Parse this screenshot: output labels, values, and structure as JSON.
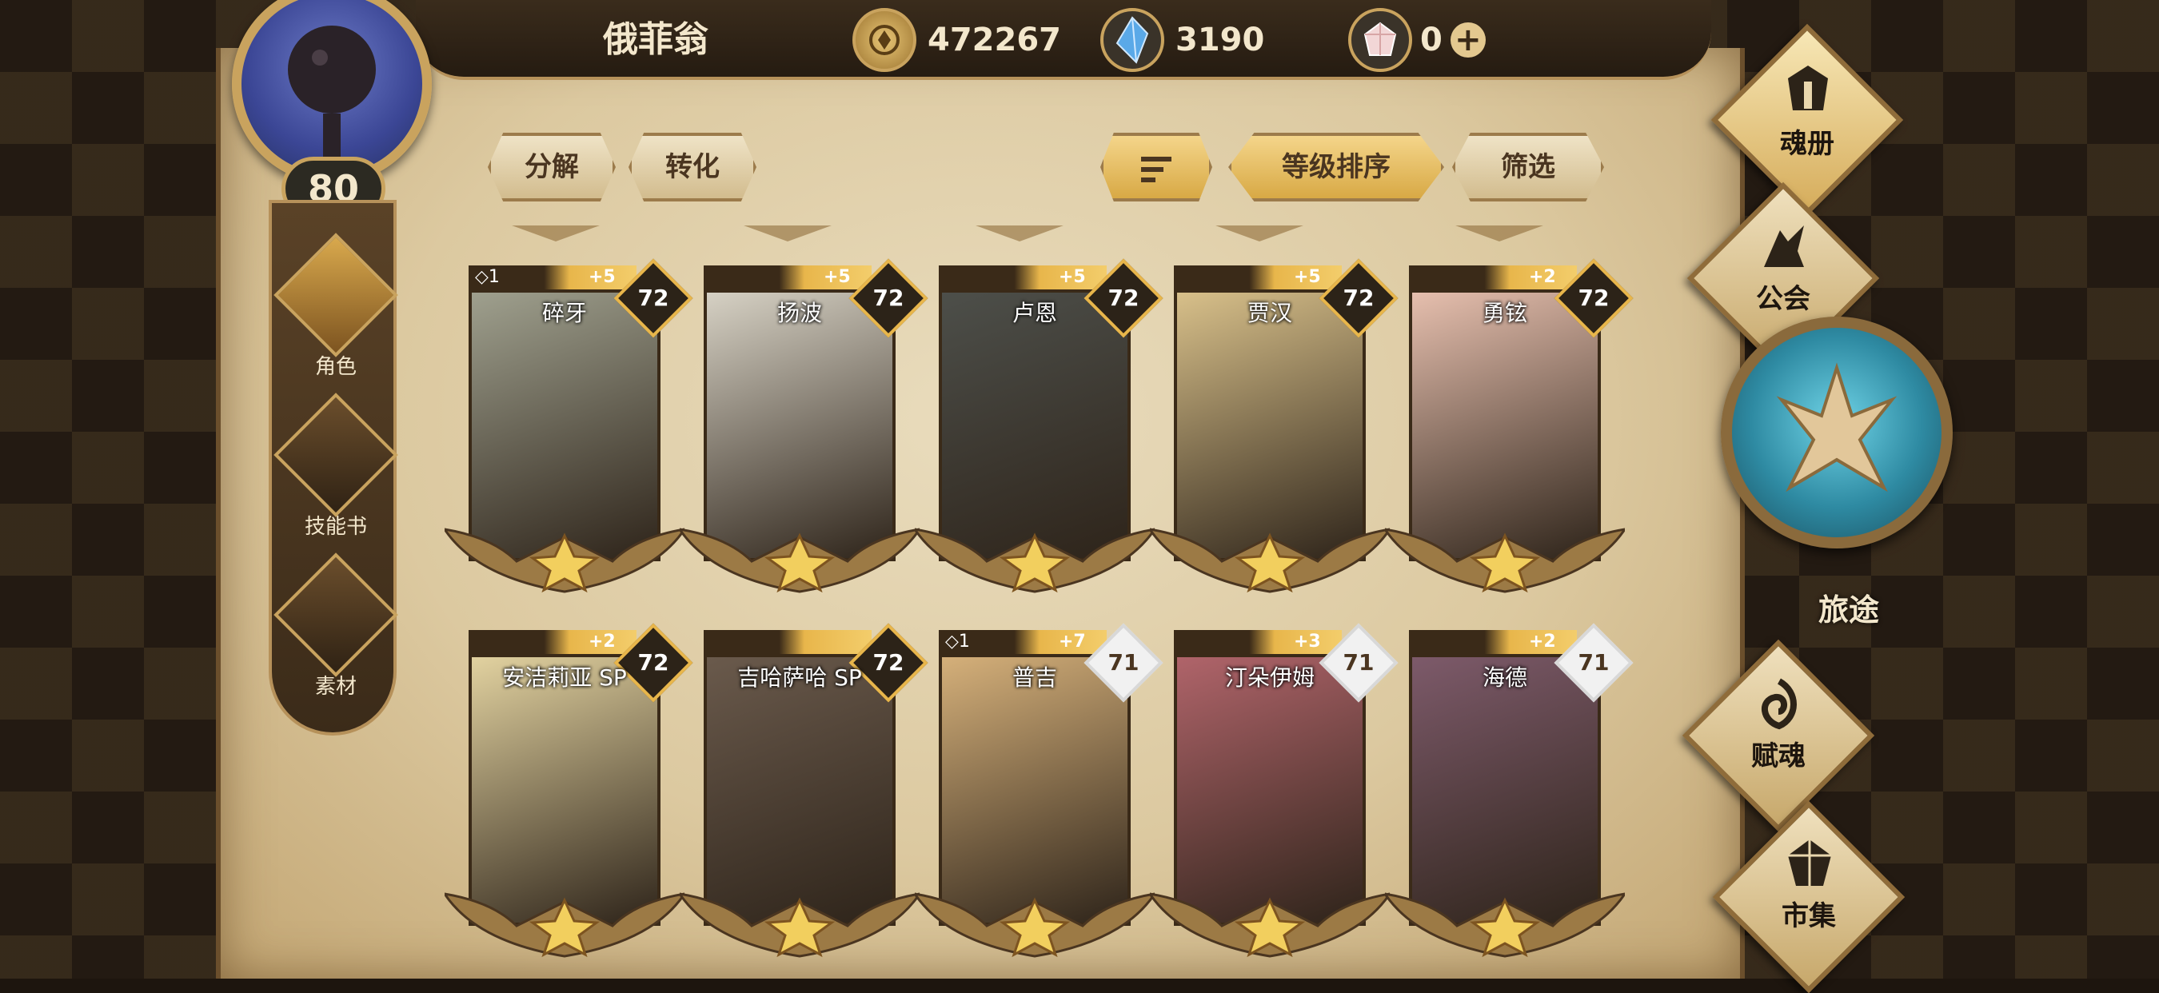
{
  "header": {
    "player_name": "俄菲翁",
    "player_level": "80",
    "gold": "472267",
    "crystal": "3190",
    "shard": "0",
    "plus_label": "+"
  },
  "sidebar": {
    "items": [
      {
        "label": "角色",
        "icon": "helmet-icon"
      },
      {
        "label": "技能书",
        "icon": "skill-book-icon"
      },
      {
        "label": "素材",
        "icon": "material-icon"
      }
    ]
  },
  "toolbar": {
    "decompose": "分解",
    "convert": "转化",
    "sort_by_level": "等级排序",
    "filter": "筛选"
  },
  "right_menu": {
    "soul_book": "魂册",
    "guild": "公会",
    "journey": "旅途",
    "endow_soul": "赋魂",
    "market": "市集"
  },
  "cards": [
    {
      "name": "碎牙",
      "plus": "+5",
      "level": "72",
      "copies": "1",
      "portrait": "#9fa08e"
    },
    {
      "name": "扬波",
      "plus": "+5",
      "level": "72",
      "copies": "",
      "portrait": "#d6d1c4"
    },
    {
      "name": "卢恩",
      "plus": "+5",
      "level": "72",
      "copies": "",
      "portrait": "#4d4f4a"
    },
    {
      "name": "贾汉",
      "plus": "+5",
      "level": "72",
      "copies": "",
      "portrait": "#d8c08a"
    },
    {
      "name": "勇铉",
      "plus": "+2",
      "level": "72",
      "copies": "",
      "portrait": "#e6bfae"
    },
    {
      "name": "安洁莉亚 SP",
      "plus": "+2",
      "level": "72",
      "copies": "",
      "portrait": "#e2d2a0"
    },
    {
      "name": "吉哈萨哈 SP",
      "plus": "",
      "level": "72",
      "copies": "",
      "portrait": "#6a5a4c"
    },
    {
      "name": "普吉",
      "plus": "+7",
      "level": "71",
      "copies": "1",
      "portrait": "#d5b07a"
    },
    {
      "name": "汀朵伊姆",
      "plus": "+3",
      "level": "71",
      "copies": "",
      "portrait": "#b0646a"
    },
    {
      "name": "海德",
      "plus": "+2",
      "level": "71",
      "copies": "",
      "portrait": "#7d5a6a"
    }
  ]
}
